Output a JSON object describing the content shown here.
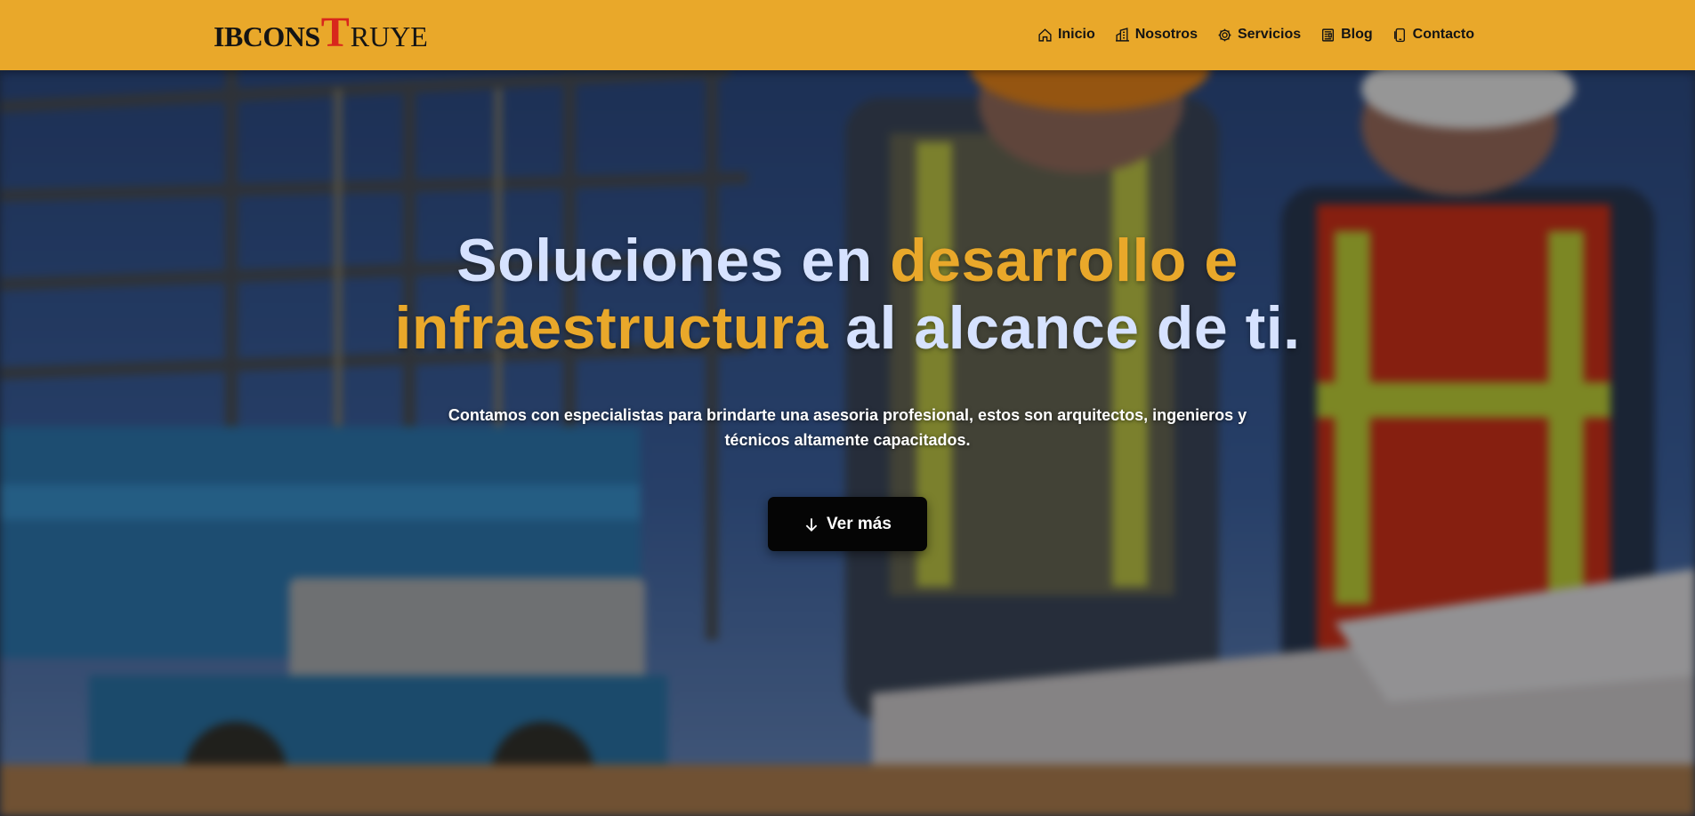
{
  "header": {
    "logo": {
      "part1": "IBCONS",
      "part2": "T",
      "part3": "RUYE"
    },
    "nav": [
      {
        "label": "Inicio",
        "icon": "home-icon"
      },
      {
        "label": "Nosotros",
        "icon": "building-icon"
      },
      {
        "label": "Servicios",
        "icon": "gear-icon"
      },
      {
        "label": "Blog",
        "icon": "newspaper-icon"
      },
      {
        "label": "Contacto",
        "icon": "phone-icon"
      }
    ]
  },
  "hero": {
    "headline": {
      "w1": "Soluciones en ",
      "w2": "desarrollo e infraestructura",
      "w3": " al alcance de ti."
    },
    "subtext": "Contamos con especialistas para brindarte una asesoria profesional, estos son arquitectos, ingenieros y técnicos altamente capacitados.",
    "cta_label": "Ver más",
    "cta_icon": "arrow-down-icon"
  },
  "colors": {
    "header_bg": "#e9a82a",
    "accent": "#e9a82a",
    "headline": "#d6e2ff",
    "logo_red": "#d8261c",
    "button_bg": "#050505"
  }
}
